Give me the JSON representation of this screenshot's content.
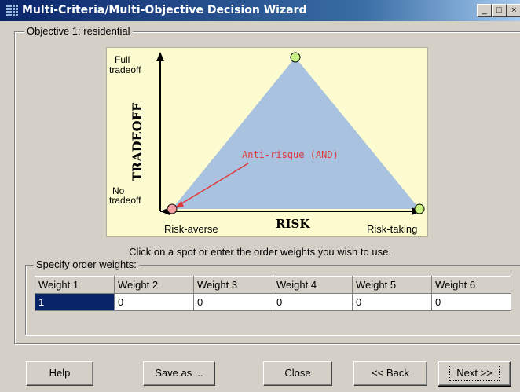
{
  "window": {
    "title": "Multi-Criteria/Multi-Objective Decision Wizard",
    "controls": [
      "minimize",
      "maximize",
      "close"
    ]
  },
  "objective_group": {
    "legend": "Objective 1: residential"
  },
  "chart": {
    "y_axis_label": "TRADEOFF",
    "y_top_label_1": "Full",
    "y_top_label_2": "tradeoff",
    "y_bottom_label_1": "No",
    "y_bottom_label_2": "tradeoff",
    "x_axis_label": "RISK",
    "x_left_label": "Risk-averse",
    "x_right_label": "Risk-taking",
    "annotation": "Anti-risque (AND)",
    "colors": {
      "background": "#fdfbd0",
      "triangle": "#a9c2e0",
      "annotation": "#e03a3a",
      "selected_point": "#f4a0a0",
      "point": "#c6f080"
    }
  },
  "hint": "Click on a spot or enter the order weights you wish to use.",
  "weights_group": {
    "legend": "Specify order weights:",
    "headers": [
      "Weight 1",
      "Weight 2",
      "Weight 3",
      "Weight 4",
      "Weight 5",
      "Weight 6"
    ],
    "values": [
      "1",
      "0",
      "0",
      "0",
      "0",
      "0"
    ]
  },
  "buttons": {
    "help": "Help",
    "save_as": "Save as ...",
    "close": "Close",
    "back": "<< Back",
    "next": "Next >>"
  }
}
